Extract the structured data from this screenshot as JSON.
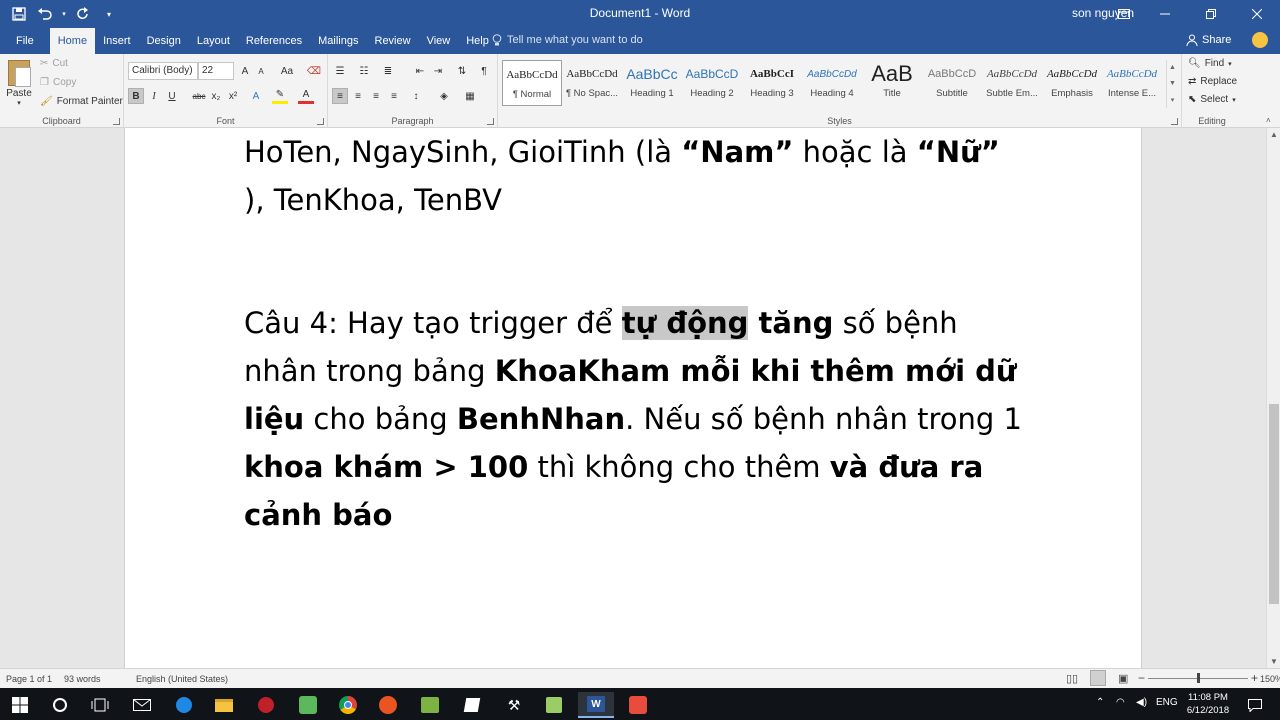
{
  "titlebar": {
    "title": "Document1  -  Word",
    "user": "son nguyen"
  },
  "tabs": [
    {
      "label": "File"
    },
    {
      "label": "Home"
    },
    {
      "label": "Insert"
    },
    {
      "label": "Design"
    },
    {
      "label": "Layout"
    },
    {
      "label": "References"
    },
    {
      "label": "Mailings"
    },
    {
      "label": "Review"
    },
    {
      "label": "View"
    },
    {
      "label": "Help"
    }
  ],
  "tellme": {
    "placeholder": "Tell me what you want to do"
  },
  "share_label": "Share",
  "clipboard": {
    "paste": "Paste",
    "cut": "Cut",
    "copy": "Copy",
    "format_painter": "Format Painter",
    "group_label": "Clipboard"
  },
  "font": {
    "font_name": "Calibri (Body)",
    "font_size": "22",
    "group_label": "Font",
    "bold": "B",
    "italic": "I",
    "underline": "U",
    "strike": "abc",
    "subscript": "x₂",
    "superscript": "x²",
    "grow": "A",
    "shrink": "A",
    "change_case": "Aa"
  },
  "paragraph": {
    "group_label": "Paragraph"
  },
  "styles": {
    "group_label": "Styles",
    "items": [
      {
        "sample": "AaBbCcDd",
        "name": "¶ Normal"
      },
      {
        "sample": "AaBbCcDd",
        "name": "¶ No Spac..."
      },
      {
        "sample": "AaBbCc",
        "name": "Heading 1"
      },
      {
        "sample": "AaBbCcD",
        "name": "Heading 2"
      },
      {
        "sample": "AaBbCcI",
        "name": "Heading 3"
      },
      {
        "sample": "AaBbCcDd",
        "name": "Heading 4"
      },
      {
        "sample": "AaB",
        "name": "Title"
      },
      {
        "sample": "AaBbCcD",
        "name": "Subtitle"
      },
      {
        "sample": "AaBbCcDd",
        "name": "Subtle Em..."
      },
      {
        "sample": "AaBbCcDd",
        "name": "Emphasis"
      },
      {
        "sample": "AaBbCcDd",
        "name": "Intense E..."
      }
    ]
  },
  "editing": {
    "group_label": "Editing",
    "find": "Find",
    "replace": "Replace",
    "select": "Select"
  },
  "document": {
    "line1": {
      "a": "HoTen, NgaySinh, GioiTinh (là ",
      "b": "“Nam”",
      "c": " hoặc là ",
      "d": "“Nữ”"
    },
    "line2": {
      "a": "), TenKhoa, TenBV"
    },
    "line3": {
      "a": "Câu 4: Hay tạo trigger để ",
      "b": "tự động",
      "c": " tăng",
      "d": " số bệnh"
    },
    "line4": {
      "a": "nhân trong bảng ",
      "b": "KhoaKham mỗi khi thêm mới dữ"
    },
    "line5": {
      "a": "liệu",
      "b": " cho bảng ",
      "c": "BenhNhan",
      "d": ". Nếu số bệnh nhân trong 1"
    },
    "line6": {
      "a": "khoa khám > 100",
      "b": " thì không cho thêm ",
      "c": "và đưa ra"
    },
    "line7": {
      "a": "cảnh báo"
    }
  },
  "statusbar": {
    "page": "Page 1 of 1",
    "words": "93 words",
    "language": "English (United States)",
    "zoom_minus": "−",
    "zoom_plus": "+",
    "zoom": "150%",
    "zoom_level": 0.5
  },
  "taskbar": {
    "time": "11:08 PM",
    "date": "6/12/2018",
    "lang": "ENG"
  }
}
